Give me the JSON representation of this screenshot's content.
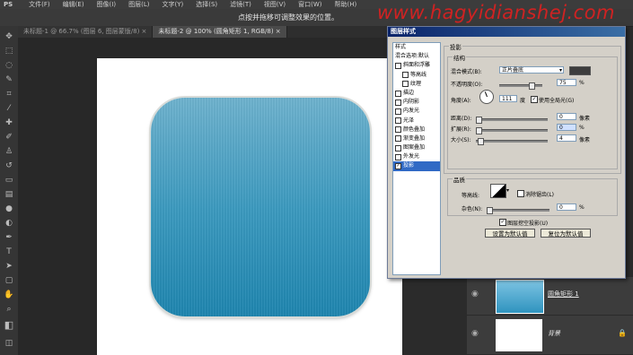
{
  "app": {
    "logo": "PS"
  },
  "menu": [
    "文件(F)",
    "编辑(E)",
    "图像(I)",
    "图层(L)",
    "文字(Y)",
    "选择(S)",
    "滤镜(T)",
    "视图(V)",
    "窗口(W)",
    "帮助(H)"
  ],
  "options_hint": "点按并拖移可调整效果的位置。",
  "watermark": "www.hagyidianshej.com",
  "tabs": [
    "未标题-1 @ 66.7% (图层 6, 图层蒙版/8) ×",
    "未标题-2 @ 100% (圆角矩形 1, RGB/8) ×"
  ],
  "dialog": {
    "title": "图层样式",
    "style_list": [
      {
        "label": "样式",
        "checkbox": false,
        "selected": false,
        "indent": false
      },
      {
        "label": "混合选项:默认",
        "checkbox": false,
        "selected": false,
        "indent": false
      },
      {
        "label": "斜面和浮雕",
        "checkbox": true,
        "checked": false,
        "selected": false,
        "indent": false
      },
      {
        "label": "等高线",
        "checkbox": true,
        "checked": false,
        "selected": false,
        "indent": true
      },
      {
        "label": "纹理",
        "checkbox": true,
        "checked": false,
        "selected": false,
        "indent": true
      },
      {
        "label": "描边",
        "checkbox": true,
        "checked": false,
        "selected": false,
        "indent": false
      },
      {
        "label": "内阴影",
        "checkbox": true,
        "checked": false,
        "selected": false,
        "indent": false
      },
      {
        "label": "内发光",
        "checkbox": true,
        "checked": false,
        "selected": false,
        "indent": false
      },
      {
        "label": "光泽",
        "checkbox": true,
        "checked": false,
        "selected": false,
        "indent": false
      },
      {
        "label": "颜色叠加",
        "checkbox": true,
        "checked": false,
        "selected": false,
        "indent": false
      },
      {
        "label": "渐变叠加",
        "checkbox": true,
        "checked": false,
        "selected": false,
        "indent": false
      },
      {
        "label": "图案叠加",
        "checkbox": true,
        "checked": false,
        "selected": false,
        "indent": false
      },
      {
        "label": "外发光",
        "checkbox": true,
        "checked": false,
        "selected": false,
        "indent": false
      },
      {
        "label": "投影",
        "checkbox": true,
        "checked": true,
        "selected": true,
        "indent": false
      }
    ],
    "section_title": "投影",
    "structure": {
      "title": "结构",
      "blend_mode_label": "混合模式(B):",
      "blend_mode_value": "正片叠底",
      "shadow_color": "#3d3d3d",
      "opacity_label": "不透明度(O):",
      "opacity_value": "75",
      "opacity_unit": "%",
      "opacity_fraction": 0.75,
      "angle_label": "角度(A):",
      "angle_value": "111",
      "angle_unit": "度",
      "global_light_label": "使用全局光(G)",
      "global_light_checked": true,
      "distance_label": "距离(D):",
      "distance_value": "0",
      "distance_unit": "像素",
      "spread_label": "扩展(R):",
      "spread_value": "0",
      "spread_unit": "%",
      "size_label": "大小(S):",
      "size_value": "4",
      "size_unit": "像素"
    },
    "quality": {
      "title": "品质",
      "contour_label": "等高线:",
      "antialias_label": "消除锯齿(L)",
      "antialias_checked": false,
      "noise_label": "杂色(N):",
      "noise_value": "0",
      "noise_unit": "%"
    },
    "knockout_label": "图层挖空投影(U)",
    "knockout_checked": true,
    "btn_set_default": "设置为默认值",
    "btn_reset_default": "复位为默认值"
  },
  "layers": [
    {
      "name": "圆角矩形 1"
    },
    {
      "name": "背景"
    }
  ]
}
